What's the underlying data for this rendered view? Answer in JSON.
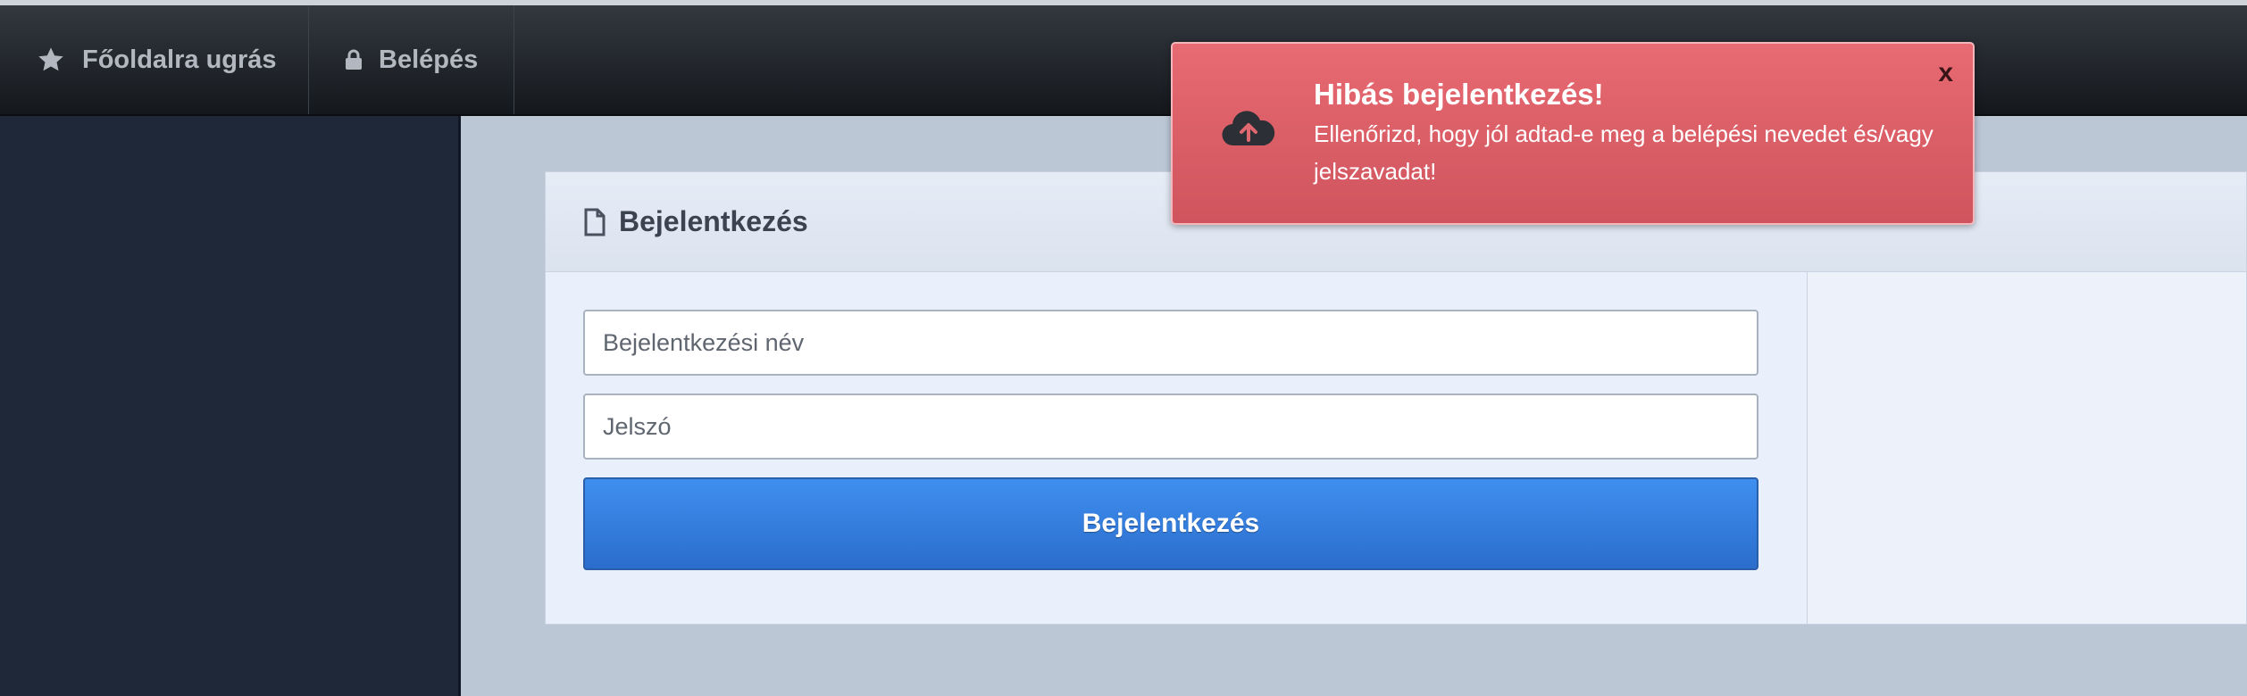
{
  "navbar": {
    "items": [
      {
        "label": "Főoldalra ugrás",
        "icon": "star-icon"
      },
      {
        "label": "Belépés",
        "icon": "lock-icon"
      }
    ]
  },
  "login_panel": {
    "title": "Bejelentkezés",
    "title_icon": "document-icon",
    "username": {
      "placeholder": "Bejelentkezési név",
      "value": ""
    },
    "password": {
      "placeholder": "Jelszó",
      "value": ""
    },
    "submit_label": "Bejelentkezés",
    "submit_color": "#3a86e6"
  },
  "toast": {
    "title": "Hibás bejelentkezés!",
    "message": "Ellenőrizd, hogy jól adtad-e meg a belépési nevedet és/vagy jelszavadat!",
    "close_label": "x",
    "icon": "cloud-upload-icon",
    "color": "#e06870"
  }
}
